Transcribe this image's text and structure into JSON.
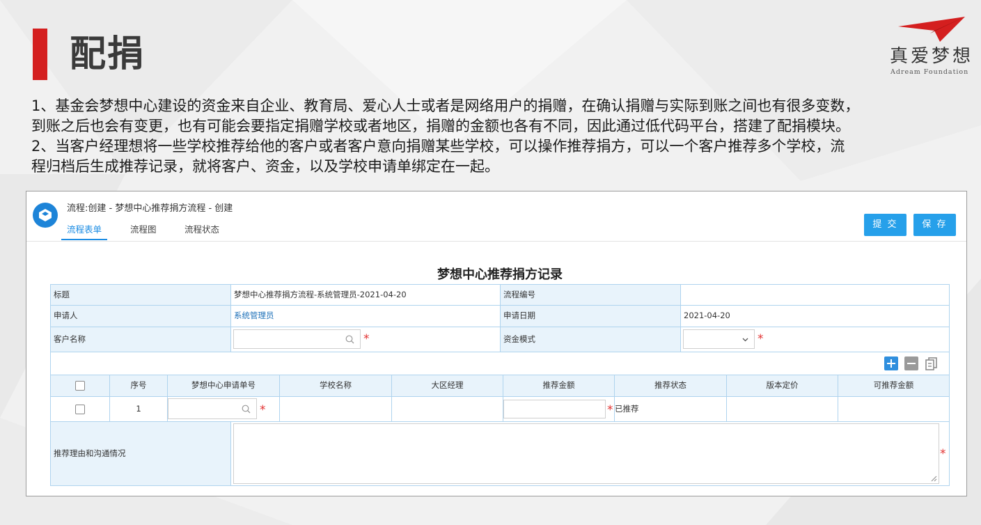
{
  "slide": {
    "title": "配捐",
    "logo_cn": "真爱梦想",
    "logo_en": "Adream Foundation",
    "lines": [
      "1、基金会梦想中心建设的资金来自企业、教育局、爱心人士或者是网络用户的捐赠，在确认捐赠与实际到账之间也有很多变数，",
      "到账之后也会有变更，也有可能会要指定捐赠学校或者地区，捐赠的金额也各有不同，因此通过低代码平台，搭建了配捐模块。",
      "2、当客户经理想将一些学校推荐给他的客户或者客户意向捐赠某些学校，可以操作推荐捐方，可以一个客户推荐多个学校，流",
      "程归档后生成推荐记录，就将客户、资金，以及学校申请单绑定在一起。"
    ]
  },
  "app": {
    "header_title": "流程:创建 - 梦想中心推荐捐方流程 - 创建",
    "tabs": [
      "流程表单",
      "流程图",
      "流程状态"
    ],
    "submit_label": "提 交",
    "save_label": "保 存",
    "accent_color": "#1b8ce3"
  },
  "form": {
    "title": "梦想中心推荐捐方记录",
    "fields": {
      "title_label": "标题",
      "title_value": "梦想中心推荐捐方流程-系统管理员-2021-04-20",
      "process_no_label": "流程编号",
      "process_no_value": "",
      "applicant_label": "申请人",
      "applicant_value": "系统管理员",
      "apply_date_label": "申请日期",
      "apply_date_value": "2021-04-20",
      "customer_label": "客户名称",
      "customer_value": "",
      "fund_mode_label": "资金模式",
      "fund_mode_value": ""
    },
    "detail": {
      "columns": [
        "序号",
        "梦想中心申请单号",
        "学校名称",
        "大区经理",
        "推荐金额",
        "推荐状态",
        "版本定价",
        "可推荐金额"
      ],
      "rows": [
        {
          "seq": "1",
          "app_no": "",
          "school": "",
          "manager": "",
          "amount": "",
          "status": "已推荐",
          "price": "",
          "available": ""
        }
      ],
      "icons": [
        "add-row-icon",
        "remove-row-icon",
        "copy-row-icon"
      ]
    },
    "reason_label": "推荐理由和沟通情况",
    "reason_value": ""
  }
}
